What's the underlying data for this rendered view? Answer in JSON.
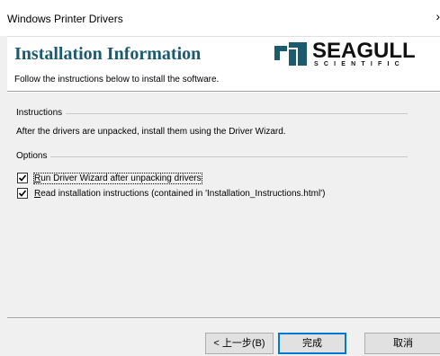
{
  "window": {
    "title": "Windows Printer Drivers",
    "close_label": "›"
  },
  "banner": {
    "heading": "Installation Information",
    "subtitle": "Follow the instructions below to install the software.",
    "logo_word": "SEAGULL",
    "logo_sub": "SCIENTIFIC",
    "heading_color": "#1c5b6e"
  },
  "instructions": {
    "group_title": "Instructions",
    "text": "After the drivers are unpacked, install them using the Driver Wizard."
  },
  "options": {
    "group_title": "Options",
    "items": [
      {
        "label": "Run Driver Wizard after unpacking drivers",
        "checked": true
      },
      {
        "label": "Read installation instructions (contained in 'Installation_Instructions.html')",
        "checked": true
      }
    ]
  },
  "buttons": {
    "back": "< 上一步(B)",
    "finish": "完成",
    "cancel": "取消"
  }
}
